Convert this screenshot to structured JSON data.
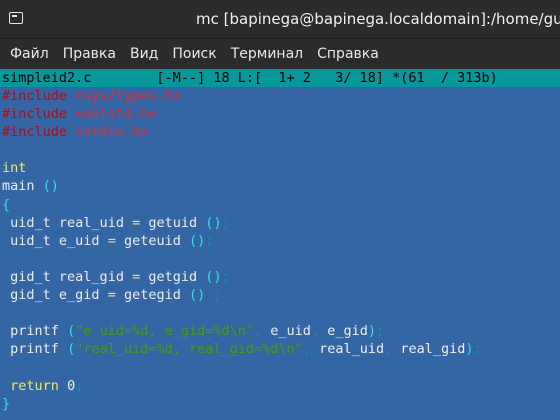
{
  "window": {
    "title": "mc [bapinega@bapinega.localdomain]:/home/guest",
    "icon": "terminal-icon"
  },
  "menu": [
    "Файл",
    "Правка",
    "Вид",
    "Поиск",
    "Терминал",
    "Справка"
  ],
  "editor": {
    "status_line": "simpleid2.c        [-M--] 18 L:[  1+ 2   3/ 18] *(61  / 313b)",
    "lines": [
      "#include <sys/types.h>",
      "#include <unistd.h>",
      "#include <stdio.h>",
      "",
      "int",
      "main ()",
      "{",
      " uid_t real_uid = getuid ();",
      " uid_t e_uid = geteuid ();",
      "",
      " gid_t real_gid = getgid ();",
      " gid_t e_gid = getegid () ;",
      "",
      " printf (\"e_uid=%d, e_gid=%d\\n\", e_uid, e_gid);",
      " printf (\"real_uid=%d, real_gid=%d\\n\", real_uid, real_gid);",
      "",
      " return 0;",
      "}"
    ]
  },
  "colors": {
    "editor_bg": "#3465a4",
    "status_bg": "#06989a",
    "preprocessor": "#cc0000",
    "keyword": "#fce94f",
    "string": "#4e9a06"
  }
}
